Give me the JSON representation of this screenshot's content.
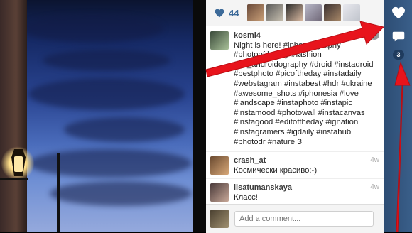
{
  "likes": {
    "count": "44"
  },
  "post": {
    "username": "kosmi4",
    "caption": "Night is here! #iphoneography #photooftheday #fashion #ua_androidography #droid #instadroid #bestphoto #picoftheday #instadaily #webstagram #instabest #hdr #ukraine #awesome_shots #iphonesia #love #landscape #instaphoto #instapic #instamood #photowall #instacanvas #instagood #editoftheday #ignation #instagramers #igdaily #instahub #photodr #nature З"
  },
  "comments": [
    {
      "username": "crash_at",
      "text": "Космически красиво:-)",
      "time": "4w"
    },
    {
      "username": "lisatumanskaya",
      "text": "Класс!",
      "time": "4w"
    }
  ],
  "comment_input": {
    "placeholder": "Add a comment..."
  },
  "rail": {
    "comment_count": "3"
  },
  "close_label": "×",
  "colors": {
    "accent": "#3c6a99",
    "rail": "#3a5f8a",
    "arrow": "#e8141c"
  }
}
